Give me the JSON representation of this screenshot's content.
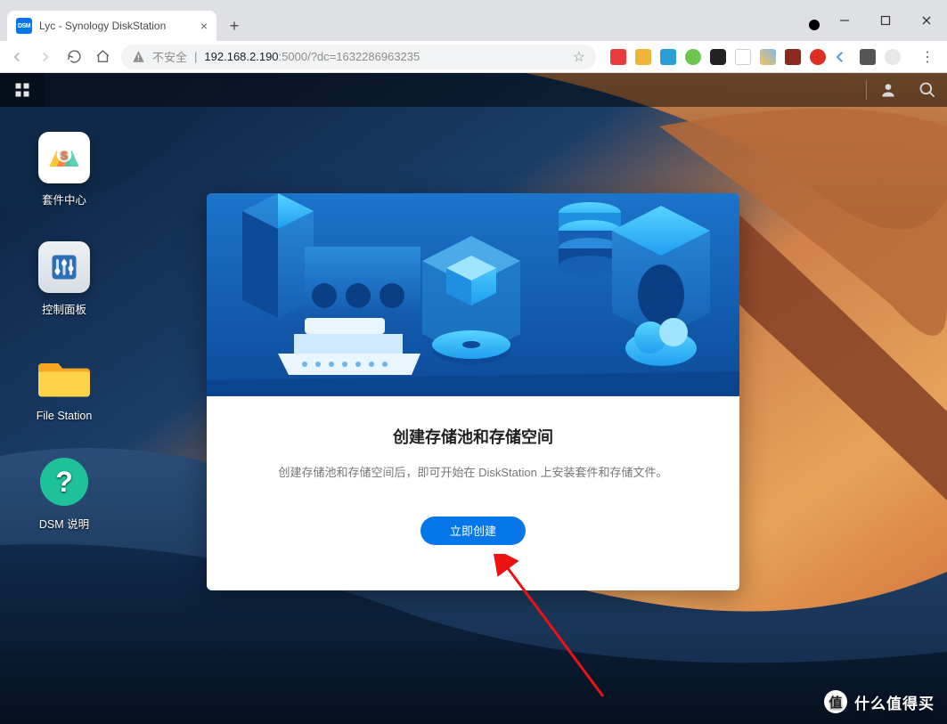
{
  "browser": {
    "tab": {
      "favicon_text": "DSM",
      "title": "Lyc - Synology DiskStation"
    },
    "url": {
      "security_label": "不安全",
      "host": "192.168.2.190",
      "port": ":5000",
      "path": "/?dc=1632286963235"
    }
  },
  "dsm": {
    "shortcuts": {
      "package_center": "套件中心",
      "control_panel": "控制面板",
      "file_station": "File Station",
      "help": "DSM 说明"
    }
  },
  "modal": {
    "title": "创建存储池和存储空间",
    "description": "创建存储池和存储空间后，即可开始在 DiskStation 上安装套件和存储文件。",
    "button_label": "立即创建"
  },
  "watermark": {
    "badge": "值",
    "text": "什么值得买"
  }
}
